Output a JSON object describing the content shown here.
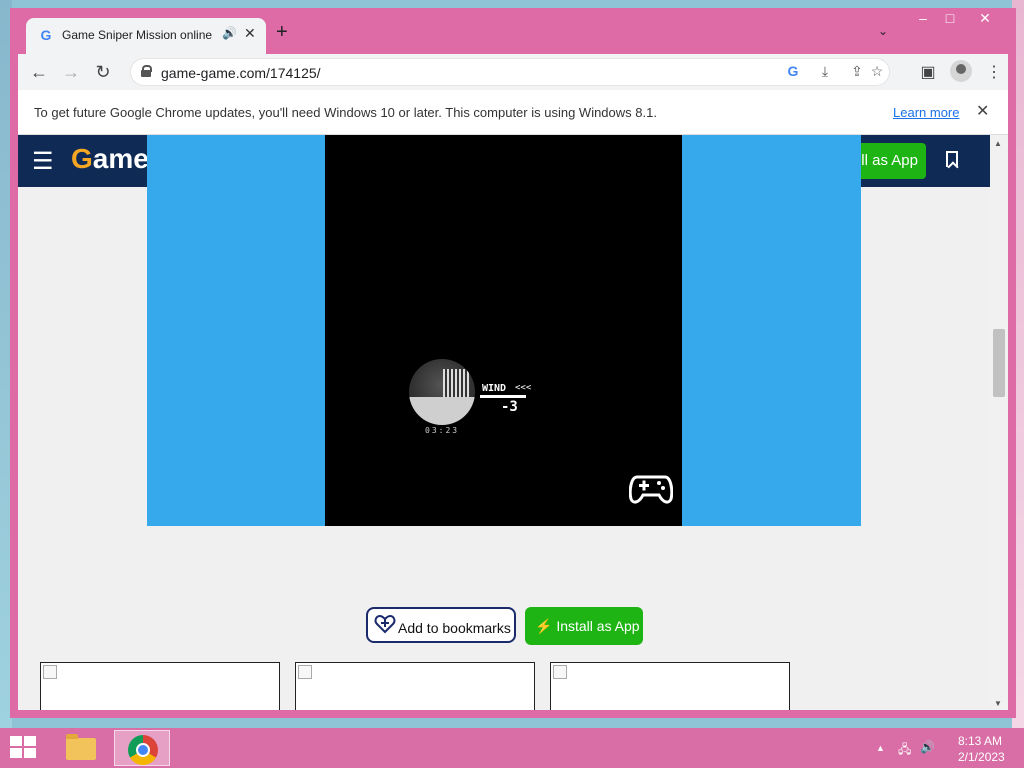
{
  "browser": {
    "tab": {
      "favicon": "google-g-icon",
      "title": "Game Sniper Mission online.",
      "audio_icon": "speaker-icon",
      "close_icon": "close-icon"
    },
    "new_tab_icon": "plus-icon",
    "url": "game-game.com/174125/",
    "window_controls": [
      "minimize",
      "maximize",
      "close"
    ]
  },
  "infobar": {
    "message": "To get future Google Chrome updates, you'll need Windows 10 or later. This computer is using Windows 8.1.",
    "link": "Learn more"
  },
  "site": {
    "logo_first": "G",
    "logo_rest": "ame",
    "header_install": "ll as App",
    "header_bookmark_icon": "bookmark-icon"
  },
  "game": {
    "wind_label": "WIND",
    "wind_arrows": "<<<",
    "wind_value": "-3",
    "timer": "03:23"
  },
  "actions": {
    "add_bookmarks": "Add to bookmarks",
    "install_app": "⚡ Install as App"
  },
  "thumbnails_count": 3,
  "taskbar": {
    "time": "8:13 AM",
    "date": "2/1/2023",
    "apps": [
      "file-explorer",
      "chrome"
    ]
  },
  "colors": {
    "window_frame": "#de6aa6",
    "site_header": "#0f2a55",
    "game_bg": "#35a9ec",
    "install_green": "#1db414",
    "logo_accent": "#f5a623"
  }
}
